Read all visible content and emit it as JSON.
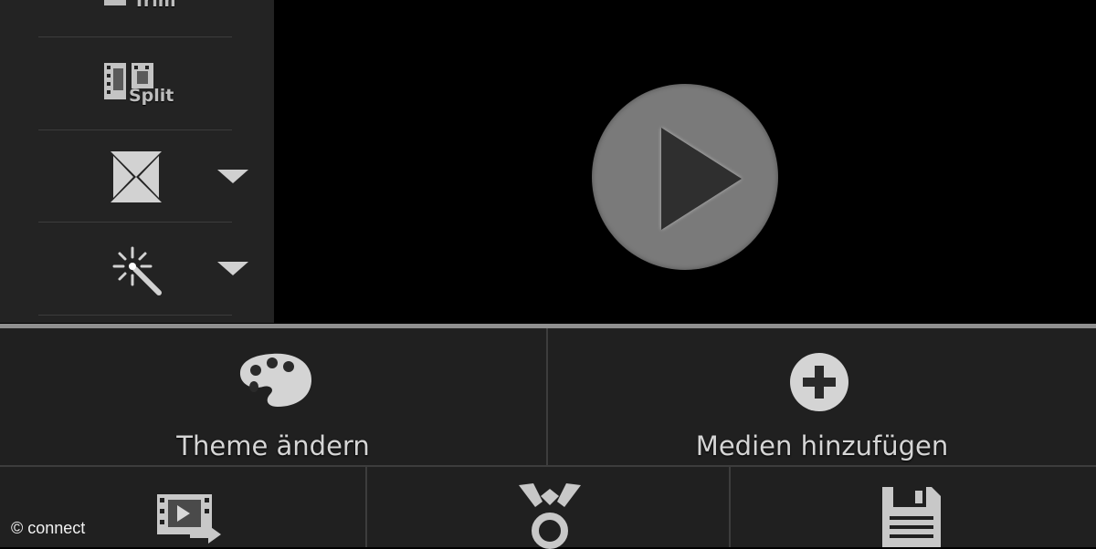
{
  "sidebar": {
    "tools": [
      {
        "name": "trim",
        "caption": "Trim",
        "icon": "trim-filmstrip-icon"
      },
      {
        "name": "split",
        "caption": "Split",
        "icon": "split-filmstrip-icon"
      },
      {
        "name": "transition",
        "caption": "",
        "icon": "transition-bowtie-icon",
        "has_dropdown": true
      },
      {
        "name": "effects",
        "caption": "",
        "icon": "magic-wand-icon",
        "has_dropdown": true
      }
    ]
  },
  "preview": {
    "play_icon": "play-icon"
  },
  "actions": {
    "theme_label": "Theme ändern",
    "theme_icon": "palette-icon",
    "add_media_label": "Medien hinzufügen",
    "add_media_icon": "plus-circle-icon",
    "export_icon": "film-export-icon",
    "share_icon": "share-icon",
    "save_icon": "floppy-disk-icon"
  },
  "watermark": "© connect",
  "colors": {
    "background": "#000000",
    "panel": "#202020",
    "sidebar": "#232323",
    "play_button": "#7a7a7a",
    "text": "#d5d5d5"
  }
}
